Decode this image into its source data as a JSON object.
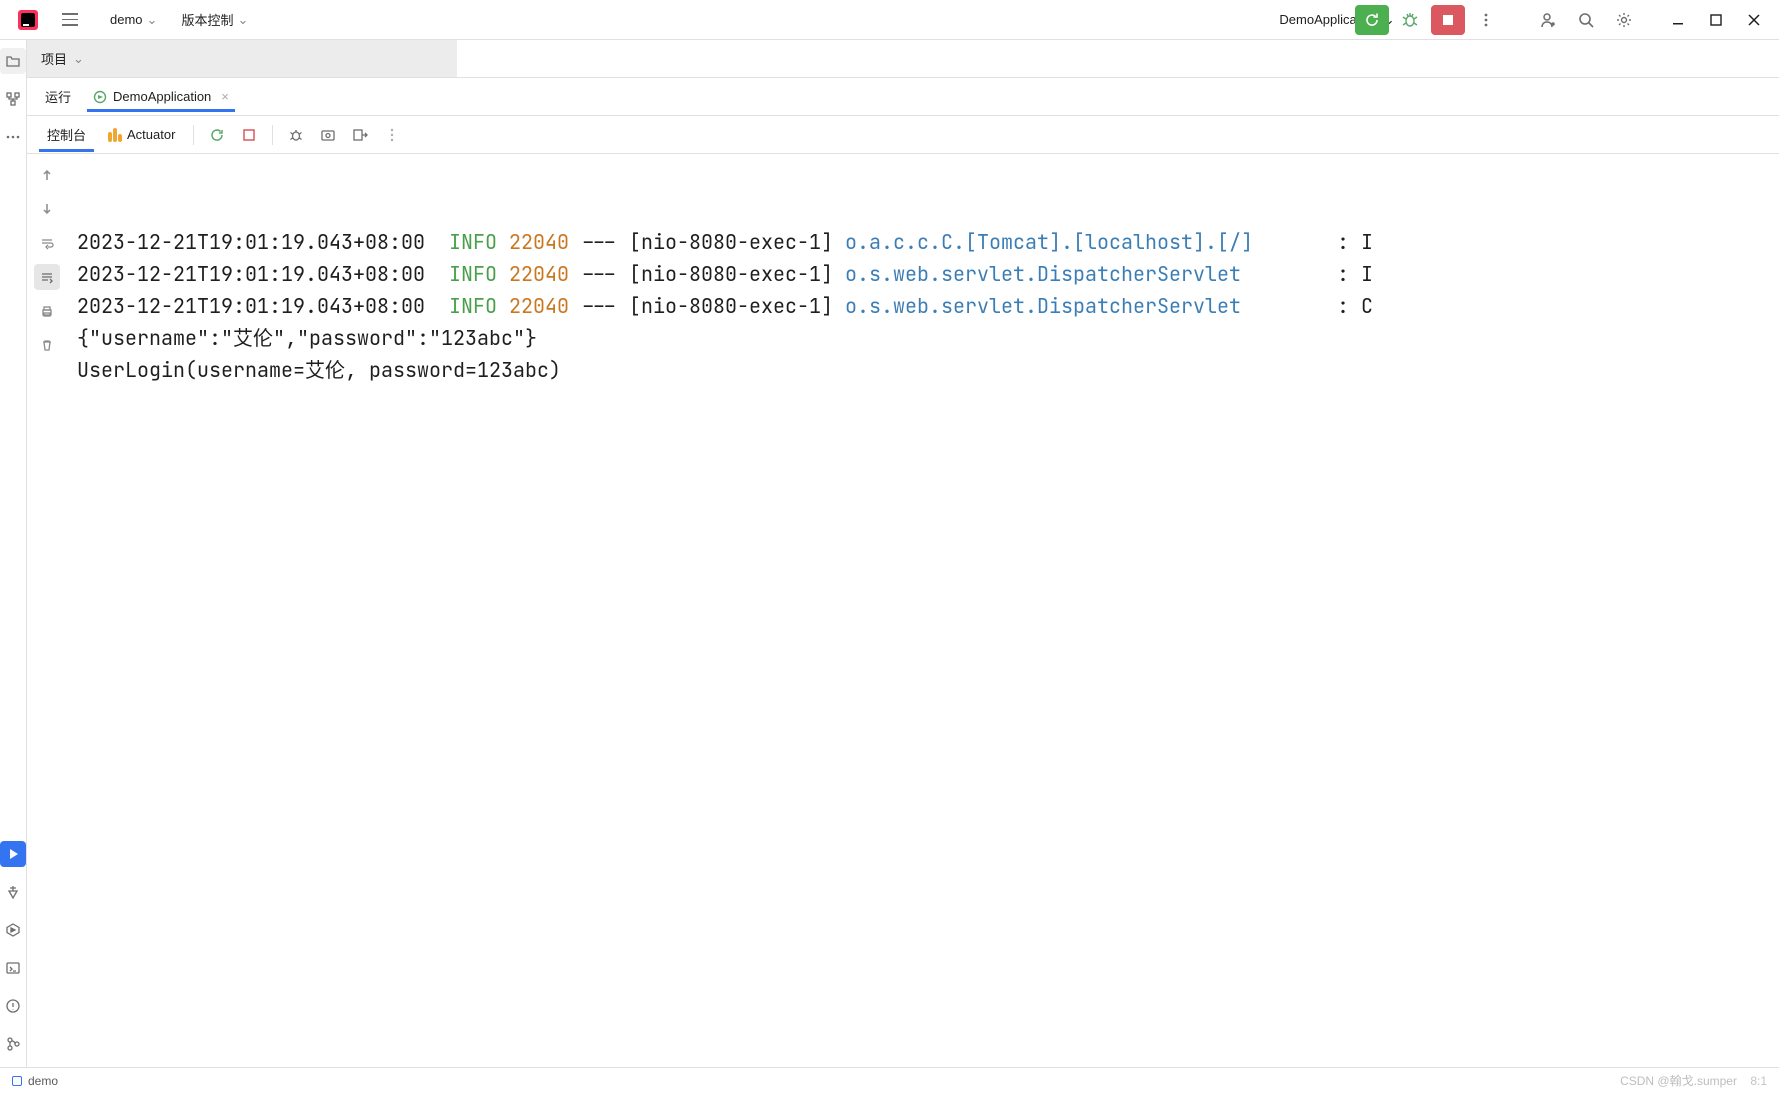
{
  "menubar": {
    "project_name": "demo",
    "vcs_label": "版本控制",
    "run_config_name": "DemoApplication"
  },
  "breadcrumb": {
    "label": "项目"
  },
  "run_panel": {
    "title": "运行",
    "tab_app": "DemoApplication"
  },
  "subtabs": {
    "console": "控制台",
    "actuator": "Actuator"
  },
  "console": {
    "lines": [
      {
        "time": "2023-12-21T19:01:19.043+08:00",
        "level": "INFO",
        "pid": "22040",
        "dash": "---",
        "thread": "[nio-8080-exec-1]",
        "logger": "o.a.c.c.C.[Tomcat].[localhost].[/]",
        "tail": ": I"
      },
      {
        "time": "2023-12-21T19:01:19.043+08:00",
        "level": "INFO",
        "pid": "22040",
        "dash": "---",
        "thread": "[nio-8080-exec-1]",
        "logger": "o.s.web.servlet.DispatcherServlet",
        "tail": ": I"
      },
      {
        "time": "2023-12-21T19:01:19.043+08:00",
        "level": "INFO",
        "pid": "22040",
        "dash": "---",
        "thread": "[nio-8080-exec-1]",
        "logger": "o.s.web.servlet.DispatcherServlet",
        "tail": ": C"
      }
    ],
    "plain_lines": [
      "{\"username\":\"艾伦\",\"password\":\"123abc\"}",
      "UserLogin(username=艾伦, password=123abc)"
    ]
  },
  "statusbar": {
    "module": "demo",
    "watermark": "CSDN @翰戈.sumper",
    "cursor": "8:1"
  }
}
